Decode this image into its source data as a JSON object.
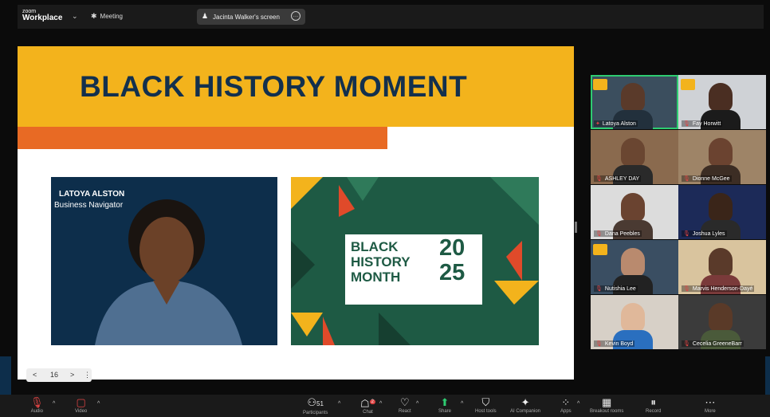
{
  "topbar": {
    "logo_small": "zoom",
    "logo_big": "Workplace",
    "chevron": "⌄",
    "meeting_label": "Meeting",
    "screen_label": "Jacinta Walker's screen"
  },
  "slide": {
    "title": "BLACK HISTORY MOMENT",
    "speaker_name": "LATOYA ALSTON",
    "speaker_role": "Business Navigator",
    "bhm_line1": "BLACK",
    "bhm_line2": "HISTORY",
    "bhm_line3": "MONTH",
    "bhm_year_top": "20",
    "bhm_year_bottom": "25",
    "bhm_subtitle": "AFRICAN AMERICANS AND LABOR",
    "colors": {
      "band": "#f3b31c",
      "stripe": "#e86a24",
      "navy": "#13304d",
      "green": "#1e5a44"
    }
  },
  "pager": {
    "prev": "<",
    "page": "16",
    "next": ">",
    "more": "⋮"
  },
  "participants": [
    {
      "name": "Latoya Alston",
      "bg": "#3b4e5e",
      "skin": "#5a3a2a",
      "shirt": "#22303c"
    },
    {
      "name": "Fay Horwitt",
      "bg": "#cfd2d6",
      "skin": "#4a2e22",
      "shirt": "#1b1b1b"
    },
    {
      "name": "ASHLEY DAY",
      "bg": "#8a6a4e",
      "skin": "#6a4631",
      "shirt": "#2a2a2a"
    },
    {
      "name": "Dionne McGee",
      "bg": "#9e8467",
      "skin": "#6b4330",
      "shirt": "#3c2d24"
    },
    {
      "name": "Dana Peebles",
      "bg": "#dcdcdc",
      "skin": "#6a4330",
      "shirt": "#4a3a32"
    },
    {
      "name": "Joshua Lyles",
      "bg": "#1c2a58",
      "skin": "#3a2519",
      "shirt": "#2a2a2a"
    },
    {
      "name": "Nutishia Lee",
      "bg": "#3a4e62",
      "skin": "#b98a6e",
      "shirt": "#222"
    },
    {
      "name": "Marvis Henderson-Dayé",
      "bg": "#d9c49e",
      "skin": "#5a3a2a",
      "shirt": "#7a3a3a"
    },
    {
      "name": "Kevin Boyd",
      "bg": "#d7d0c7",
      "skin": "#e0b89a",
      "shirt": "#2a6fbf"
    },
    {
      "name": "Cecelia GreeneBarr",
      "bg": "#3b3b3b",
      "skin": "#5a3a28",
      "shirt": "#4a5a3a"
    }
  ],
  "toolbar": {
    "audio": "Audio",
    "video": "Video",
    "participants_count": "51",
    "participants": "Participants",
    "chat_badge": "2",
    "chat": "Chat",
    "react": "React",
    "share": "Share",
    "host_tools": "Host tools",
    "ai_companion": "AI Companion",
    "apps": "Apps",
    "breakout_rooms": "Breakout rooms",
    "record": "Record",
    "more": "More"
  }
}
